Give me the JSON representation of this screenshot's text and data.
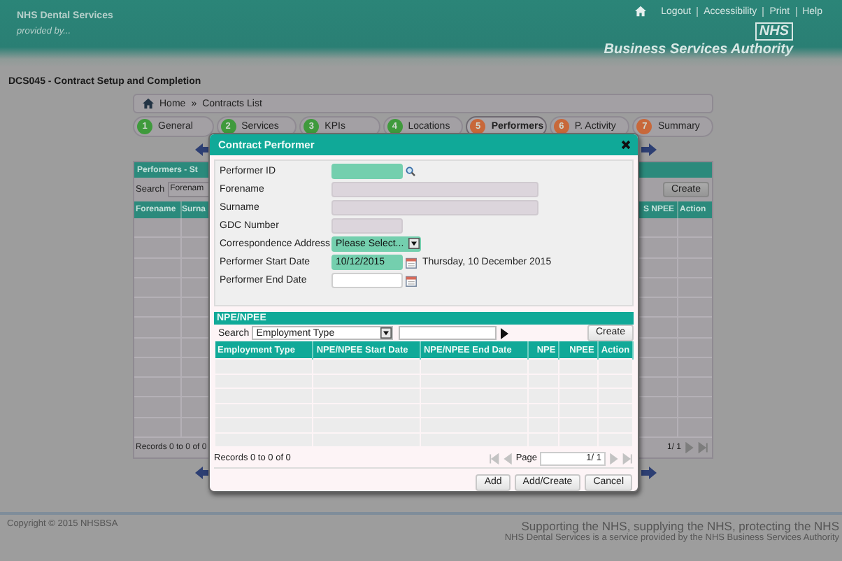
{
  "header": {
    "org": "NHS Dental Services",
    "tagline": "provided by...",
    "logo": "NHS",
    "authority": "Business Services Authority",
    "links": [
      "Logout",
      "Accessibility",
      "Print",
      "Help"
    ]
  },
  "page_title": "DCS045 - Contract Setup and Completion",
  "breadcrumb": {
    "items": [
      "Home",
      "Contracts List"
    ],
    "separator": "»"
  },
  "steps": [
    {
      "number": "1",
      "label": "General",
      "color": "#3f9a3c",
      "selected": false
    },
    {
      "number": "2",
      "label": "Services",
      "color": "#3f9a3c",
      "selected": false
    },
    {
      "number": "3",
      "label": "KPIs",
      "color": "#3f9a3c",
      "selected": false
    },
    {
      "number": "4",
      "label": "Locations",
      "color": "#3f9a3c",
      "selected": false
    },
    {
      "number": "5",
      "label": "Performers",
      "color": "#c8683a",
      "selected": true
    },
    {
      "number": "6",
      "label": "P. Activity",
      "color": "#c8683a",
      "selected": false
    },
    {
      "number": "7",
      "label": "Summary",
      "color": "#c8683a",
      "selected": false
    }
  ],
  "background_panel": {
    "title": "Performers - St",
    "search_label": "Search",
    "search_value": "Forenam",
    "create": "Create",
    "columns_left": [
      "Forename",
      "Surna"
    ],
    "columns_right": [
      "S NPEE",
      "Action"
    ],
    "records": "Records 0 to 0 of 0",
    "page": "1/ 1"
  },
  "dialog": {
    "title": "Contract Performer",
    "fields": [
      {
        "label": "Performer ID",
        "kind": "lookup",
        "required": true,
        "disabled": false
      },
      {
        "label": "Forename",
        "kind": "text",
        "required": false,
        "disabled": true
      },
      {
        "label": "Surname",
        "kind": "text",
        "required": false,
        "disabled": true
      },
      {
        "label": "GDC Number",
        "kind": "code",
        "required": false,
        "disabled": true
      },
      {
        "label": "Correspondence Address",
        "kind": "select",
        "required": true,
        "disabled": false,
        "value": "Please Select..."
      },
      {
        "label": "Performer Start Date",
        "kind": "date",
        "required": true,
        "disabled": false,
        "value": "10/12/2015",
        "note": "Thursday, 10 December 2015"
      },
      {
        "label": "Performer End Date",
        "kind": "date",
        "required": false,
        "disabled": false
      }
    ],
    "npe": {
      "title": "NPE/NPEE",
      "search_label": "Search",
      "search_by": "Employment Type",
      "create": "Create",
      "columns": [
        "Employment Type",
        "NPE/NPEE Start Date",
        "NPE/NPEE End Date",
        "NPE",
        "NPEE",
        "Action"
      ],
      "records": "Records 0 to 0 of 0",
      "page_label": "Page",
      "page": "1/ 1"
    },
    "buttons": [
      "Add",
      "Add/Create",
      "Cancel"
    ]
  },
  "footer": {
    "copyright": "Copyright © 2015 NHSBSA",
    "slogan": "Supporting the NHS, supplying the NHS, protecting the NHS",
    "provided": "NHS Dental Services is a service provided by the NHS Business Services Authority"
  }
}
